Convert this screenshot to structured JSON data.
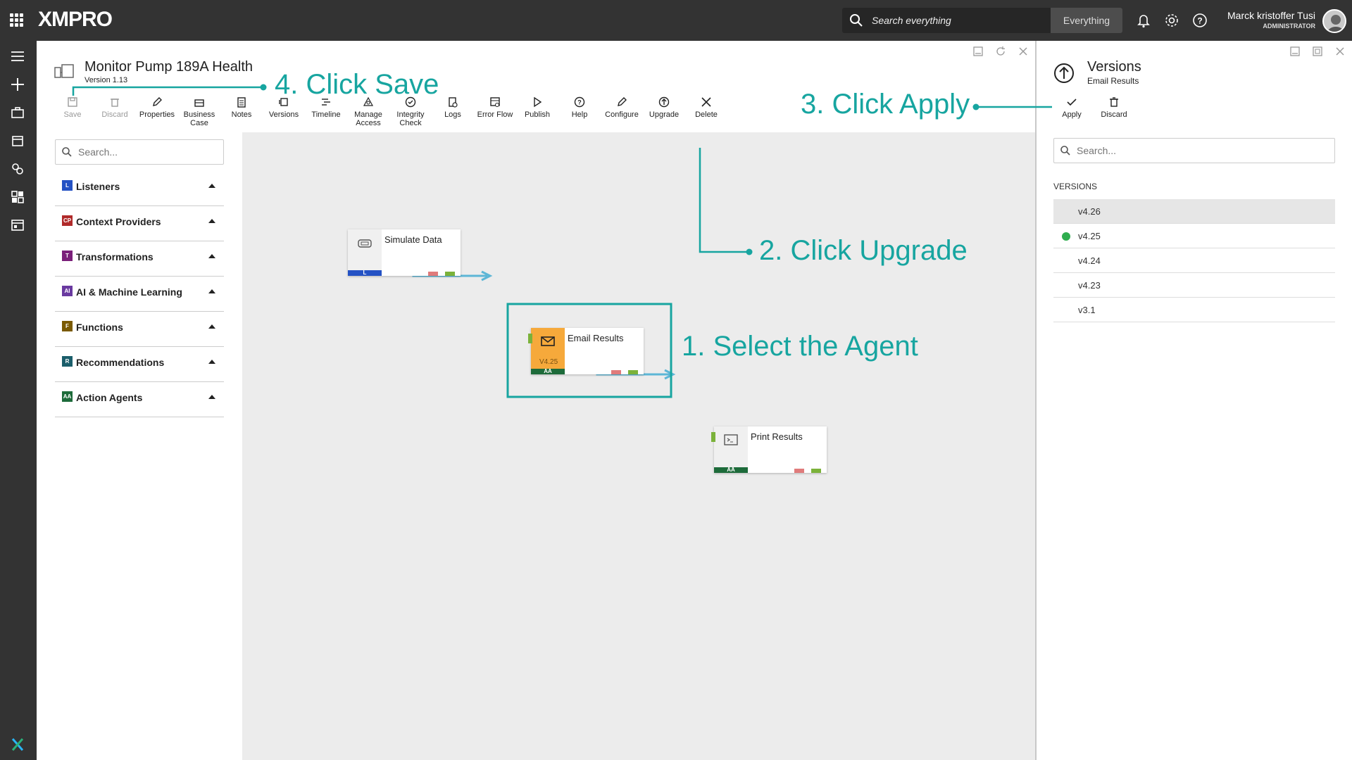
{
  "topbar": {
    "logo": "XMPRO",
    "search_placeholder": "Search everything",
    "search_scope": "Everything",
    "user_name": "Marck kristoffer Tusi",
    "user_role": "ADMINISTRATOR"
  },
  "stream": {
    "title": "Monitor Pump 189A Health",
    "version": "Version 1.13"
  },
  "toolbar": [
    {
      "label": "Save",
      "icon": "save-icon",
      "disabled": true
    },
    {
      "label": "Discard",
      "icon": "trash-icon",
      "disabled": true
    },
    {
      "label": "Properties",
      "icon": "pencil-icon",
      "disabled": false
    },
    {
      "label": "Business Case",
      "icon": "briefcase-icon",
      "disabled": false
    },
    {
      "label": "Notes",
      "icon": "notes-icon",
      "disabled": false
    },
    {
      "label": "Versions",
      "icon": "versions-icon",
      "disabled": false
    },
    {
      "label": "Timeline",
      "icon": "timeline-icon",
      "disabled": false
    },
    {
      "label": "Manage Access",
      "icon": "access-icon",
      "disabled": false
    },
    {
      "label": "Integrity Check",
      "icon": "check-circle-icon",
      "disabled": false
    },
    {
      "label": "Logs",
      "icon": "logs-icon",
      "disabled": false
    },
    {
      "label": "Error Flow",
      "icon": "error-flow-icon",
      "disabled": false
    },
    {
      "label": "Publish",
      "icon": "play-icon",
      "disabled": false
    },
    {
      "label": "Help",
      "icon": "help-icon",
      "disabled": false
    },
    {
      "label": "Configure",
      "icon": "pencil-icon",
      "disabled": false
    },
    {
      "label": "Upgrade",
      "icon": "upgrade-icon",
      "disabled": false
    },
    {
      "label": "Delete",
      "icon": "close-icon",
      "disabled": false
    }
  ],
  "toolbox": {
    "search_placeholder": "Search...",
    "categories": [
      {
        "label": "Listeners",
        "badge": "L",
        "color": "#2452c4"
      },
      {
        "label": "Context Providers",
        "badge": "CP",
        "color": "#b02a2a"
      },
      {
        "label": "Transformations",
        "badge": "T",
        "color": "#7b1f7a"
      },
      {
        "label": "AI & Machine Learning",
        "badge": "AI",
        "color": "#6a3aa0"
      },
      {
        "label": "Functions",
        "badge": "F",
        "color": "#7a5a00"
      },
      {
        "label": "Recommendations",
        "badge": "R",
        "color": "#1b5e6b"
      },
      {
        "label": "Action Agents",
        "badge": "AA",
        "color": "#1d6b3a"
      }
    ]
  },
  "canvas": {
    "nodes": [
      {
        "name": "Simulate Data",
        "badge": "L",
        "badge_color": "#2452c4"
      },
      {
        "name": "Email Results",
        "badge": "AA",
        "badge_color": "#1d6b3a",
        "version": "V4.25",
        "accent": "#f6a93b"
      },
      {
        "name": "Print Results",
        "badge": "AA",
        "badge_color": "#1d6b3a"
      }
    ]
  },
  "versions_panel": {
    "title": "Versions",
    "subtitle": "Email Results",
    "apply_label": "Apply",
    "discard_label": "Discard",
    "search_placeholder": "Search...",
    "section_label": "VERSIONS",
    "items": [
      {
        "label": "v4.26",
        "selected": true,
        "current": false
      },
      {
        "label": "v4.25",
        "selected": false,
        "current": true
      },
      {
        "label": "v4.24",
        "selected": false,
        "current": false
      },
      {
        "label": "v4.23",
        "selected": false,
        "current": false
      },
      {
        "label": "v3.1",
        "selected": false,
        "current": false
      }
    ]
  },
  "annotations": {
    "step1": "1. Select the Agent",
    "step2": "2. Click Upgrade",
    "step3": "3. Click Apply",
    "step4": "4. Click Save",
    "color": "#17a5a0"
  }
}
